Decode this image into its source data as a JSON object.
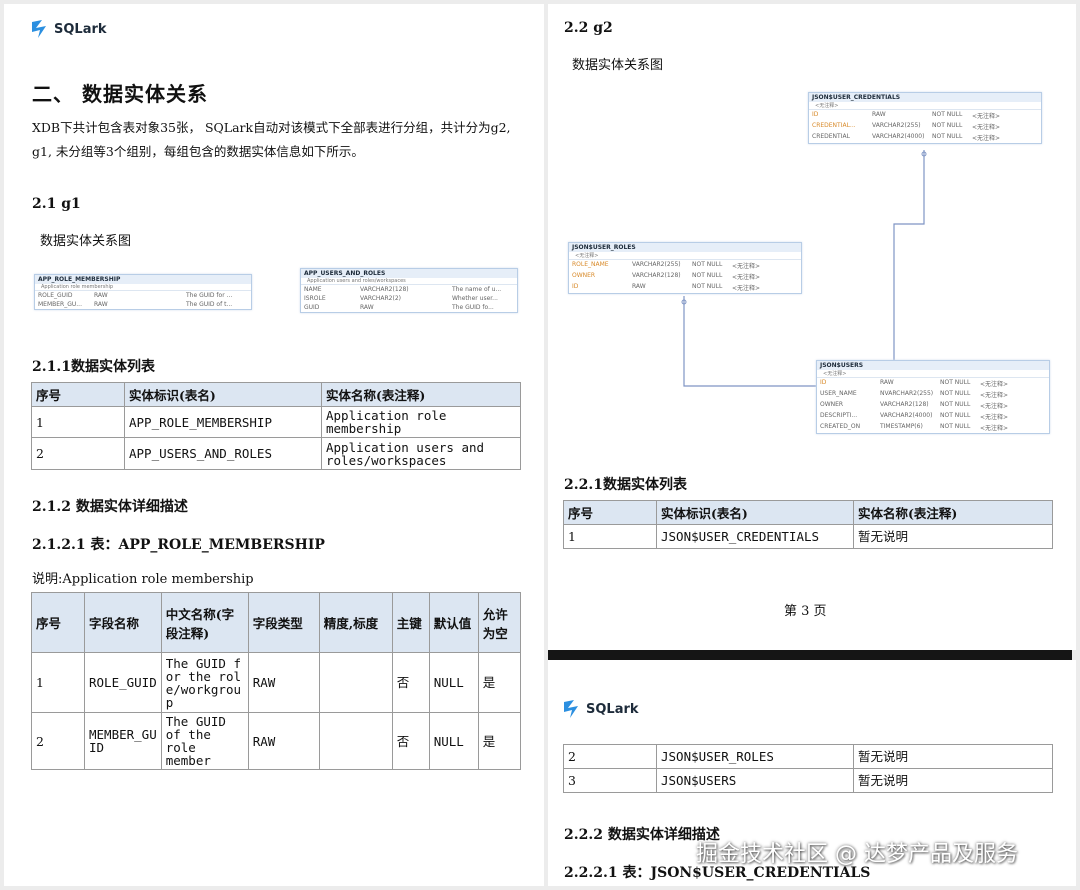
{
  "logo": {
    "text": "SQLark",
    "color": "#2b8fe0"
  },
  "left": {
    "section_title": "二、 数据实体关系",
    "intro": "XDB下共计包含表对象35张， SQLark自动对该模式下全部表进行分组，共计分为g2, g1, 未分组等3个组别，每组包含的数据实体信息如下所示。",
    "g1_title": "2.1 g1",
    "g1_caption": "数据实体关系图",
    "g1_entities": [
      {
        "name": "APP_ROLE_MEMBERSHIP",
        "comment": "Application role membership",
        "rows": [
          [
            "ROLE_GUID",
            "RAW",
            "The GUID for ..."
          ],
          [
            "MEMBER_GU...",
            "RAW",
            "The GUID of t..."
          ]
        ]
      },
      {
        "name": "APP_USERS_AND_ROLES",
        "comment": "Application users and roles/workspaces",
        "rows": [
          [
            "NAME",
            "VARCHAR2(128)",
            "The name of u..."
          ],
          [
            "ISROLE",
            "VARCHAR2(2)",
            "Whether user..."
          ],
          [
            "GUID",
            "RAW",
            "The GUID fo..."
          ]
        ]
      }
    ],
    "list_title": "2.1.1数据实体列表",
    "list_headers": [
      "序号",
      "实体标识(表名)",
      "实体名称(表注释)"
    ],
    "list_rows": [
      [
        "1",
        "APP_ROLE_MEMBERSHIP",
        "Application role membership"
      ],
      [
        "2",
        "APP_USERS_AND_ROLES",
        "Application users and roles/workspaces"
      ]
    ],
    "detail_title": "2.1.2 数据实体详细描述",
    "table_title": "2.1.2.1 表：APP_ROLE_MEMBERSHIP",
    "table_desc": "说明:Application role membership",
    "field_headers": [
      "序号",
      "字段名称",
      "中文名称(字段注释)",
      "字段类型",
      "精度,标度",
      "主键",
      "默认值",
      "允许为空"
    ],
    "field_rows": [
      [
        "1",
        "ROLE_GUID",
        "The GUID for the role/workgroup",
        "RAW",
        "",
        "否",
        "NULL",
        "是"
      ],
      [
        "2",
        "MEMBER_GUID",
        "The GUID of the role member",
        "RAW",
        "",
        "否",
        "NULL",
        "是"
      ]
    ]
  },
  "right": {
    "g2_title": "2.2 g2",
    "g2_caption": "数据实体关系图",
    "g2_entities": [
      {
        "name": "JSON$USER_CREDENTIALS",
        "comment": "<无注释>",
        "rows": [
          [
            "ID",
            "RAW",
            "NOT NULL",
            "<无注释>"
          ],
          [
            "CREDENTIAL...",
            "VARCHAR2(255)",
            "NOT NULL",
            "<无注释>"
          ],
          [
            "CREDENTIAL",
            "VARCHAR2(4000)",
            "NOT NULL",
            "<无注释>"
          ]
        ]
      },
      {
        "name": "JSON$USER_ROLES",
        "comment": "<无注释>",
        "rows": [
          [
            "ROLE_NAME",
            "VARCHAR2(255)",
            "NOT NULL",
            "<无注释>"
          ],
          [
            "OWNER",
            "VARCHAR2(128)",
            "NOT NULL",
            "<无注释>"
          ],
          [
            "ID",
            "RAW",
            "NOT NULL",
            "<无注释>"
          ]
        ]
      },
      {
        "name": "JSON$USERS",
        "comment": "<无注释>",
        "rows": [
          [
            "ID",
            "RAW",
            "NOT NULL",
            "<无注释>"
          ],
          [
            "USER_NAME",
            "NVARCHAR2(255)",
            "NOT NULL",
            "<无注释>"
          ],
          [
            "OWNER",
            "VARCHAR2(128)",
            "NOT NULL",
            "<无注释>"
          ],
          [
            "DESCRIPTI...",
            "VARCHAR2(4000)",
            "NOT NULL",
            "<无注释>"
          ],
          [
            "CREATED_ON",
            "TIMESTAMP(6)",
            "NOT NULL",
            "<无注释>"
          ]
        ]
      }
    ],
    "list_title": "2.2.1数据实体列表",
    "list_headers": [
      "序号",
      "实体标识(表名)",
      "实体名称(表注释)"
    ],
    "list_rows_page1": [
      [
        "1",
        "JSON$USER_CREDENTIALS",
        "暂无说明"
      ]
    ],
    "page_number": "第 3 页",
    "list_rows_page2": [
      [
        "2",
        "JSON$USER_ROLES",
        "暂无说明"
      ],
      [
        "3",
        "JSON$USERS",
        "暂无说明"
      ]
    ],
    "detail_title": "2.2.2 数据实体详细描述",
    "table_title": "2.2.2.1 表：JSON$USER_CREDENTIALS"
  },
  "watermark": "掘金技术社区 @ 达梦产品及服务"
}
